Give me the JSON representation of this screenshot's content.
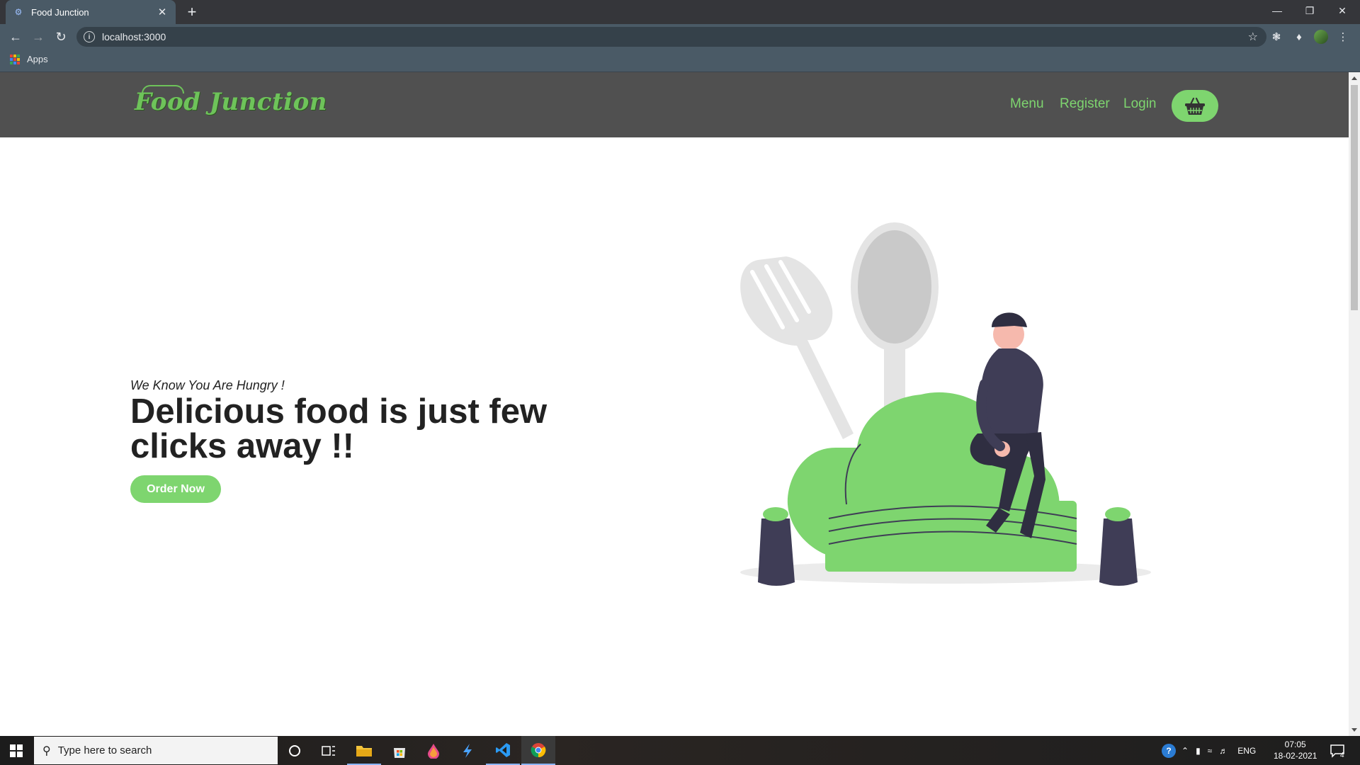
{
  "browser": {
    "tab_title": "Food Junction",
    "url": "localhost:3000",
    "bookmarks": {
      "apps_label": "Apps"
    }
  },
  "site": {
    "logo": "Food Junction",
    "nav": {
      "menu": "Menu",
      "register": "Register",
      "login": "Login"
    },
    "hero": {
      "tagline": "We Know You Are Hungry !",
      "headline": "Delicious food is just few clicks away !!",
      "cta": "Order Now"
    },
    "colors": {
      "accent": "#7ed56f",
      "navbar": "#505050",
      "ink": "#3f3d56"
    }
  },
  "taskbar": {
    "search_placeholder": "Type here to search",
    "lang": "ENG",
    "time": "07:05",
    "date": "18-02-2021",
    "notification_count": "4"
  }
}
